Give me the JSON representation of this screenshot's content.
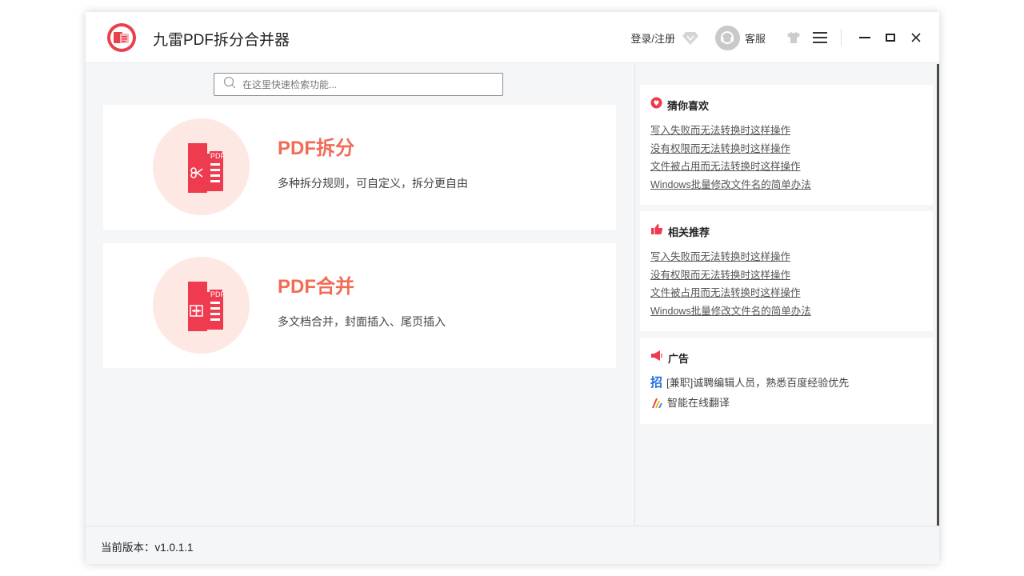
{
  "app": {
    "title": "九雷PDF拆分合并器"
  },
  "titlebar": {
    "login_label": "登录/注册",
    "service_label": "客服",
    "icons": [
      "vip-diamond-icon",
      "avatar-icon",
      "skin-shirt-icon",
      "menu-icon",
      "minimize-icon",
      "maximize-icon",
      "close-icon"
    ]
  },
  "search": {
    "placeholder": "在这里快速检索功能...",
    "value": ""
  },
  "cards": [
    {
      "title": "PDF拆分",
      "desc": "多种拆分规则，可自定义，拆分更自由",
      "badge": "PDF",
      "icon": "scissors-icon"
    },
    {
      "title": "PDF合并",
      "desc": "多文档合并，封面插入、尾页插入",
      "badge": "PDF",
      "icon": "merge-icon"
    }
  ],
  "sidebar": {
    "guess": {
      "title": "猜你喜欢",
      "links": [
        "写入失败而无法转换时这样操作",
        "没有权限而无法转换时这样操作",
        "文件被占用而无法转换时这样操作",
        "Windows批量修改文件名的简单办法"
      ]
    },
    "recommend": {
      "title": "相关推荐",
      "links": [
        "写入失败而无法转换时这样操作",
        "没有权限而无法转换时这样操作",
        "文件被占用而无法转换时这样操作",
        "Windows批量修改文件名的简单办法"
      ]
    },
    "ads": {
      "title": "广告",
      "items": [
        {
          "icon_text": "招",
          "text": "[兼职]诚聘编辑人员，熟悉百度经验优先"
        },
        {
          "text": "智能在线翻译"
        }
      ]
    }
  },
  "footer": {
    "version": "当前版本：v1.0.1.1"
  },
  "colors": {
    "accent": "#f26b55",
    "brand_red": "#ea3f4d",
    "card_circle": "#fde8e4"
  }
}
